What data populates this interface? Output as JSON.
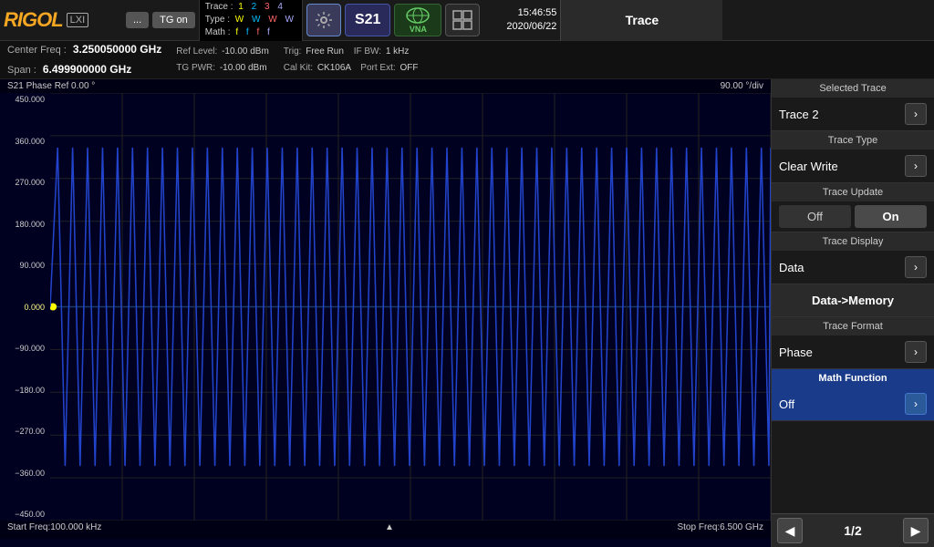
{
  "header": {
    "logo": "RIGOL",
    "lxi": "LXI",
    "btn_dots": "...",
    "btn_tg": "TG on",
    "trace_info": {
      "trace_label": "Trace :",
      "t1": "1",
      "t2": "2",
      "t3": "3",
      "t4": "4",
      "type_label": "Type :",
      "w1": "W",
      "w2": "W",
      "w3": "W",
      "w4": "W",
      "math_label": "Math :",
      "f1": "f",
      "f2": "f",
      "f3": "f",
      "f4": "f"
    },
    "s21": "S21",
    "vna": "VNA",
    "datetime": "15:46:55",
    "date": "2020/06/22"
  },
  "subheader": {
    "center_freq_label": "Center Freq :",
    "center_freq_val": "3.250050000 GHz",
    "span_label": "Span :",
    "span_val": "6.499900000 GHz",
    "ref_level_label": "Ref Level:",
    "ref_level_val": "-10.00 dBm",
    "tg_pwr_label": "TG PWR:",
    "tg_pwr_val": "-10.00 dBm",
    "trig_label": "Trig:",
    "trig_val": "Free Run",
    "if_bw_label": "IF BW:",
    "if_bw_val": "1 kHz",
    "cal_kit_label": "Cal Kit:",
    "cal_kit_val": "CK106A",
    "port_ext_label": "Port Ext:",
    "port_ext_val": "OFF"
  },
  "chart": {
    "header_left": "S21  Phase   Ref 0.00 °",
    "header_right": "90.00 °/div",
    "footer_left": "Start Freq:100.000 kHz",
    "footer_center": "▲",
    "footer_right": "Stop Freq:6.500 GHz",
    "y_labels": [
      "450.000",
      "360.000",
      "270.000",
      "180.000",
      "90.000",
      "0.000",
      "−90.000",
      "−180.00",
      "−270.00",
      "−360.00",
      "−450.00"
    ]
  },
  "right_panel": {
    "title": "Trace",
    "selected_trace_label": "Selected Trace",
    "selected_trace_value": "Trace 2",
    "trace_type_label": "Trace Type",
    "trace_type_value": "Clear Write",
    "trace_update_label": "Trace Update",
    "off_label": "Off",
    "on_label": "On",
    "trace_display_label": "Trace Display",
    "trace_display_value": "Data",
    "data_memory_label": "Data->Memory",
    "trace_format_label": "Trace Format",
    "trace_format_value": "Phase",
    "math_function_label": "Math Function",
    "math_function_value": "Off",
    "page_indicator": "1/2",
    "nav_prev": "◀",
    "nav_next": "▶"
  }
}
